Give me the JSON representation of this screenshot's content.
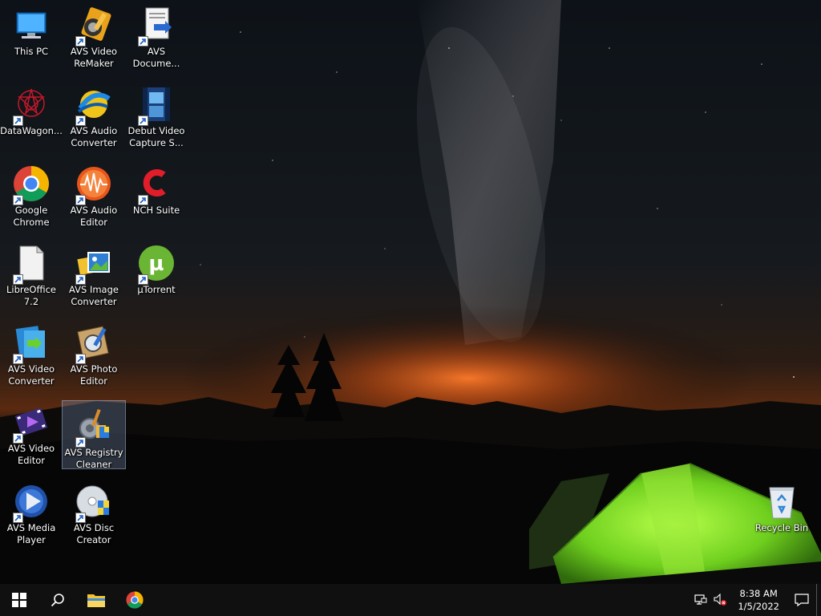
{
  "desktop": {
    "icons": [
      {
        "line1": "This PC",
        "line2": "",
        "icon": "this-pc-icon",
        "shortcut": false,
        "selected": false
      },
      {
        "line1": "AVS Video",
        "line2": "ReMaker",
        "icon": "avs-video-remaker-icon",
        "shortcut": true,
        "selected": false
      },
      {
        "line1": "AVS",
        "line2": "Docume...",
        "icon": "avs-document-converter-icon",
        "shortcut": true,
        "selected": false
      },
      {
        "line1": "DataWagon...",
        "line2": "",
        "icon": "datawagon-icon",
        "shortcut": true,
        "selected": false
      },
      {
        "line1": "AVS Audio",
        "line2": "Converter",
        "icon": "avs-audio-converter-icon",
        "shortcut": true,
        "selected": false
      },
      {
        "line1": "Debut Video",
        "line2": "Capture S...",
        "icon": "debut-video-capture-icon",
        "shortcut": true,
        "selected": false
      },
      {
        "line1": "Google",
        "line2": "Chrome",
        "icon": "google-chrome-icon",
        "shortcut": true,
        "selected": false
      },
      {
        "line1": "AVS Audio",
        "line2": "Editor",
        "icon": "avs-audio-editor-icon",
        "shortcut": true,
        "selected": false
      },
      {
        "line1": "NCH Suite",
        "line2": "",
        "icon": "nch-suite-icon",
        "shortcut": true,
        "selected": false
      },
      {
        "line1": "LibreOffice",
        "line2": "7.2",
        "icon": "libreoffice-icon",
        "shortcut": true,
        "selected": false
      },
      {
        "line1": "AVS Image",
        "line2": "Converter",
        "icon": "avs-image-converter-icon",
        "shortcut": true,
        "selected": false
      },
      {
        "line1": "µTorrent",
        "line2": "",
        "icon": "utorrent-icon",
        "shortcut": true,
        "selected": false
      },
      {
        "line1": "AVS Video",
        "line2": "Converter",
        "icon": "avs-video-converter-icon",
        "shortcut": true,
        "selected": false
      },
      {
        "line1": "AVS Photo",
        "line2": "Editor",
        "icon": "avs-photo-editor-icon",
        "shortcut": true,
        "selected": false
      },
      {
        "line1": "AVS Video",
        "line2": "Editor",
        "icon": "avs-video-editor-icon",
        "shortcut": true,
        "selected": false
      },
      {
        "line1": "AVS Registry",
        "line2": "Cleaner",
        "icon": "avs-registry-cleaner-icon",
        "shortcut": true,
        "selected": true
      },
      {
        "line1": "AVS Media",
        "line2": "Player",
        "icon": "avs-media-player-icon",
        "shortcut": true,
        "selected": false
      },
      {
        "line1": "AVS Disc",
        "line2": "Creator",
        "icon": "avs-disc-creator-icon",
        "shortcut": true,
        "selected": false
      },
      {
        "line1": "Recycle Bin",
        "line2": "",
        "icon": "recycle-bin-icon",
        "shortcut": false,
        "selected": false
      }
    ]
  },
  "taskbar": {
    "buttons": [
      {
        "icon": "windows-start-icon"
      },
      {
        "icon": "search-icon"
      },
      {
        "icon": "file-explorer-icon"
      },
      {
        "icon": "google-chrome-icon"
      }
    ],
    "tray": {
      "network_icon": "network-icon",
      "volume_icon": "volume-muted-icon",
      "time": "8:38 AM",
      "date": "1/5/2022",
      "notification_icon": "action-center-icon"
    }
  },
  "colors": {
    "taskbar_bg": "#101010",
    "sky_top": "#0b1016",
    "horizon_glow": "#e0602a",
    "tent_green": "#7ed321"
  }
}
